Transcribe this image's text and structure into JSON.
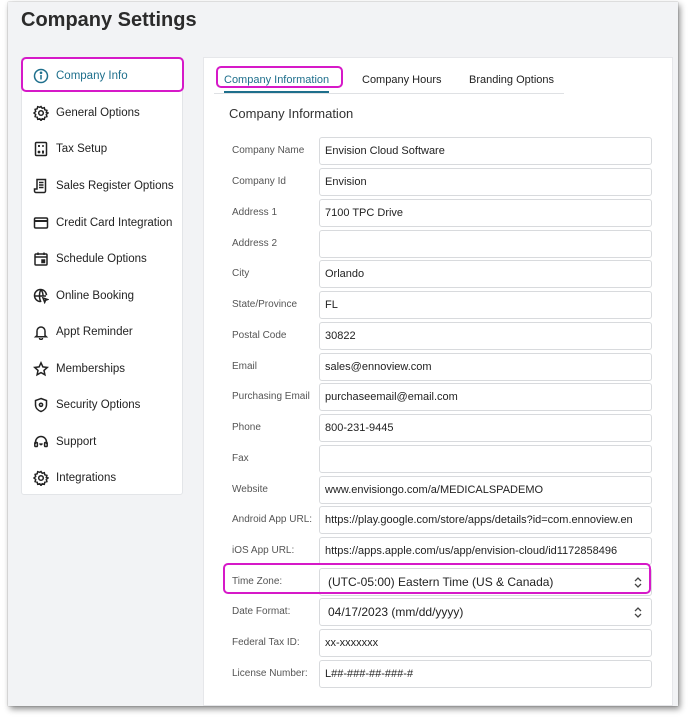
{
  "page": {
    "title": "Company Settings"
  },
  "sidebar": {
    "items": [
      {
        "label": "Company Info",
        "icon": "info-icon",
        "active": true
      },
      {
        "label": "General Options",
        "icon": "gear-icon"
      },
      {
        "label": "Tax Setup",
        "icon": "calculator-icon"
      },
      {
        "label": "Sales Register Options",
        "icon": "receipt-icon"
      },
      {
        "label": "Credit Card Integration",
        "icon": "credit-card-icon"
      },
      {
        "label": "Schedule Options",
        "icon": "calendar-icon"
      },
      {
        "label": "Online Booking",
        "icon": "globe-cursor-icon"
      },
      {
        "label": "Appt Reminder",
        "icon": "bell-icon"
      },
      {
        "label": "Memberships",
        "icon": "star-icon"
      },
      {
        "label": "Security Options",
        "icon": "shield-icon"
      },
      {
        "label": "Support",
        "icon": "headset-icon"
      },
      {
        "label": "Integrations",
        "icon": "gear-icon"
      }
    ]
  },
  "tabs": [
    {
      "label": "Company Information",
      "active": true
    },
    {
      "label": "Company Hours"
    },
    {
      "label": "Branding Options"
    }
  ],
  "form": {
    "section_title": "Company Information",
    "fields": [
      {
        "label": "Company Name",
        "value": "Envision Cloud Software"
      },
      {
        "label": "Company Id",
        "value": "Envision"
      },
      {
        "label": "Address 1",
        "value": "7100 TPC Drive"
      },
      {
        "label": "Address 2",
        "value": ""
      },
      {
        "label": "City",
        "value": "Orlando"
      },
      {
        "label": "State/Province",
        "value": "FL"
      },
      {
        "label": "Postal Code",
        "value": "30822"
      },
      {
        "label": "Email",
        "value": "sales@ennoview.com"
      },
      {
        "label": "Purchasing Email",
        "value": "purchaseemail@email.com"
      },
      {
        "label": "Phone",
        "value": "800-231-9445"
      },
      {
        "label": "Fax",
        "value": ""
      },
      {
        "label": "Website",
        "value": "www.envisiongo.com/a/MEDICALSPADEMO"
      },
      {
        "label": "Android App URL:",
        "value": "https://play.google.com/store/apps/details?id=com.ennoview.en"
      },
      {
        "label": "iOS App URL:",
        "value": "https://apps.apple.com/us/app/envision-cloud/id1172858496"
      }
    ],
    "time_zone": {
      "label": "Time Zone:",
      "value": "(UTC-05:00) Eastern Time (US & Canada)"
    },
    "date_format": {
      "label": "Date Format:",
      "value": "04/17/2023 (mm/dd/yyyy)"
    },
    "federal_tax": {
      "label": "Federal Tax ID:",
      "value": "xx-xxxxxxx"
    },
    "license": {
      "label": "License Number:",
      "value": "L##-###-##-###-#"
    }
  },
  "colors": {
    "accent": "#1e6f8c",
    "highlight": "#d619c8",
    "background": "#f2f3f5"
  }
}
